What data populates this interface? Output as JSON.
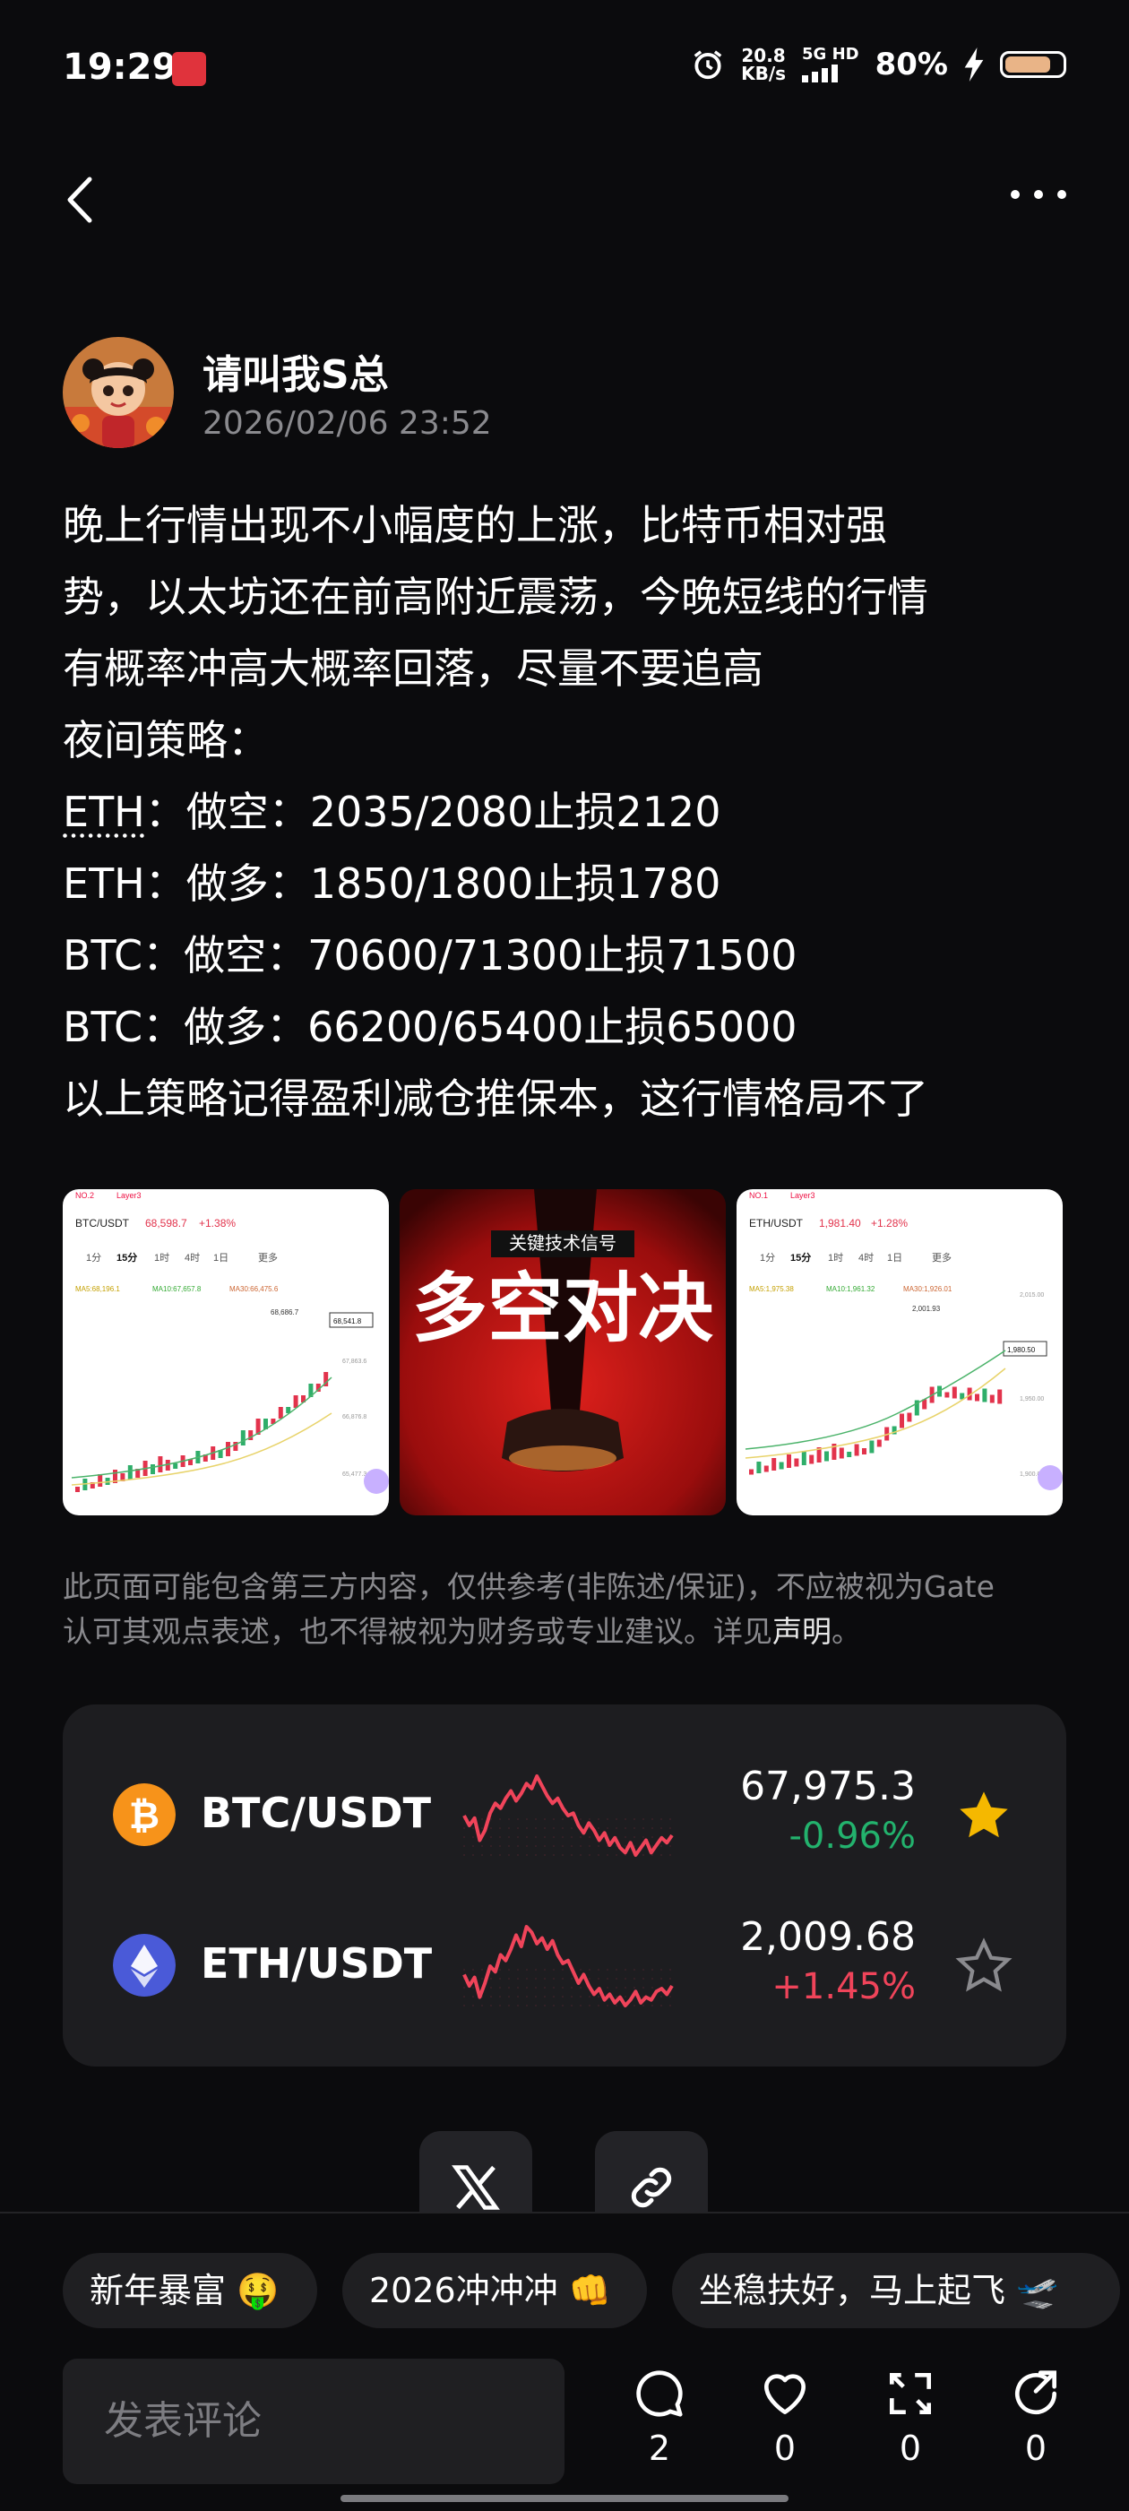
{
  "status_bar": {
    "time": "19:29",
    "net_speed_value": "20.8",
    "net_speed_unit": "KB/s",
    "signal_label_top": "5G HD",
    "battery_percent": "80%",
    "battery_level": 0.8
  },
  "author": {
    "name": "请叫我S总",
    "timestamp": "2026/02/06 23:52"
  },
  "post": {
    "lines": [
      "晚上行情出现不小幅度的上涨，比特币相对强",
      "势，以太坊还在前高附近震荡，今晚短线的行情",
      "有概率冲高大概率回落，尽量不要追高",
      "夜间策略："
    ],
    "strategy_1_coin": "ETH",
    "strategy_1_rest": "：做空：2035/2080止损2120",
    "strategy_2": "ETH：做多：1850/1800止损1780",
    "strategy_3": "BTC：做空：70600/71300止损71500",
    "strategy_4": "BTC：做多：66200/65400止损65000",
    "closing": "以上策略记得盈利减仓推保本，这行情格局不了"
  },
  "images": {
    "img1": {
      "tag": "NO.2",
      "layer": "Layer3",
      "pair": "BTC/USDT",
      "price": "68,598.7",
      "change": "+1.38%",
      "tf": [
        "1分",
        "15分",
        "1时",
        "4时",
        "1日",
        "更多"
      ],
      "ma": [
        "MA5:68,196.1",
        "MA10:67,657.8",
        "MA30:66,475.6"
      ],
      "high": "68,686.7",
      "last": "68,541.8",
      "ticks": [
        "67,863.6",
        "66,876.8",
        "65,477.3"
      ]
    },
    "img2": {
      "banner": "关键技术信号",
      "title": "多空对决"
    },
    "img3": {
      "tag": "NO.1",
      "layer": "Layer3",
      "pair": "ETH/USDT",
      "price": "1,981.40",
      "change": "+1.28%",
      "tf": [
        "1分",
        "15分",
        "1时",
        "4时",
        "1日",
        "更多"
      ],
      "ma": [
        "MA5:1,975.38",
        "MA10:1,961.32",
        "MA30:1,926.01"
      ],
      "high": "2,001.93",
      "last": "1,980.50",
      "ticks": [
        "2,015.00",
        "1,950.00",
        "1,900.00"
      ]
    }
  },
  "disclaimer": {
    "line1": "此页面可能包含第三方内容，仅供参考(非陈述/保证)，不应被视为Gate",
    "line2": "认可其观点表述，也不得被视为财务或专业建议。详见",
    "link": "声明",
    "end": "。"
  },
  "market": [
    {
      "pair": "BTC/USDT",
      "price": "67,975.3",
      "change": "-0.96%",
      "change_color": "#23b26d",
      "favorited": true,
      "icon": "bitcoin-icon",
      "coin_color": "#f7931a",
      "sparkline": [
        60,
        52,
        58,
        40,
        48,
        62,
        70,
        66,
        74,
        80,
        72,
        78,
        86,
        82,
        92,
        84,
        76,
        70,
        74,
        66,
        60,
        62,
        52,
        46,
        54,
        48,
        40,
        46,
        36,
        42,
        34,
        30,
        38,
        28,
        34,
        40,
        30,
        36,
        42,
        38,
        44
      ]
    },
    {
      "pair": "ETH/USDT",
      "price": "2,009.68",
      "change": "+1.45%",
      "change_color": "#f0445a",
      "favorited": false,
      "icon": "ethereum-icon",
      "coin_color": "#4a5ad8",
      "sparkline": [
        56,
        48,
        54,
        40,
        50,
        62,
        58,
        70,
        66,
        74,
        84,
        76,
        90,
        86,
        78,
        82,
        74,
        80,
        70,
        64,
        66,
        58,
        50,
        56,
        48,
        42,
        46,
        38,
        42,
        36,
        40,
        34,
        38,
        44,
        36,
        40,
        38,
        44,
        46,
        42,
        48
      ]
    }
  ],
  "share": {
    "x_icon": "x-logo-icon",
    "link_icon": "link-icon"
  },
  "chips": [
    {
      "label": "新年暴富 🤑"
    },
    {
      "label": "2026冲冲冲 👊"
    },
    {
      "label": "坐稳扶好，马上起飞 🛫"
    }
  ],
  "bottom": {
    "comment_placeholder": "发表评论",
    "comment_count": "2",
    "like_count": "0",
    "repost_count": "0",
    "share_count": "0"
  },
  "colors": {
    "background": "#0b0b0d",
    "card": "#1d1d20",
    "down_red": "#f0445a",
    "up_green": "#23b26d",
    "star_gold": "#f5b800"
  }
}
